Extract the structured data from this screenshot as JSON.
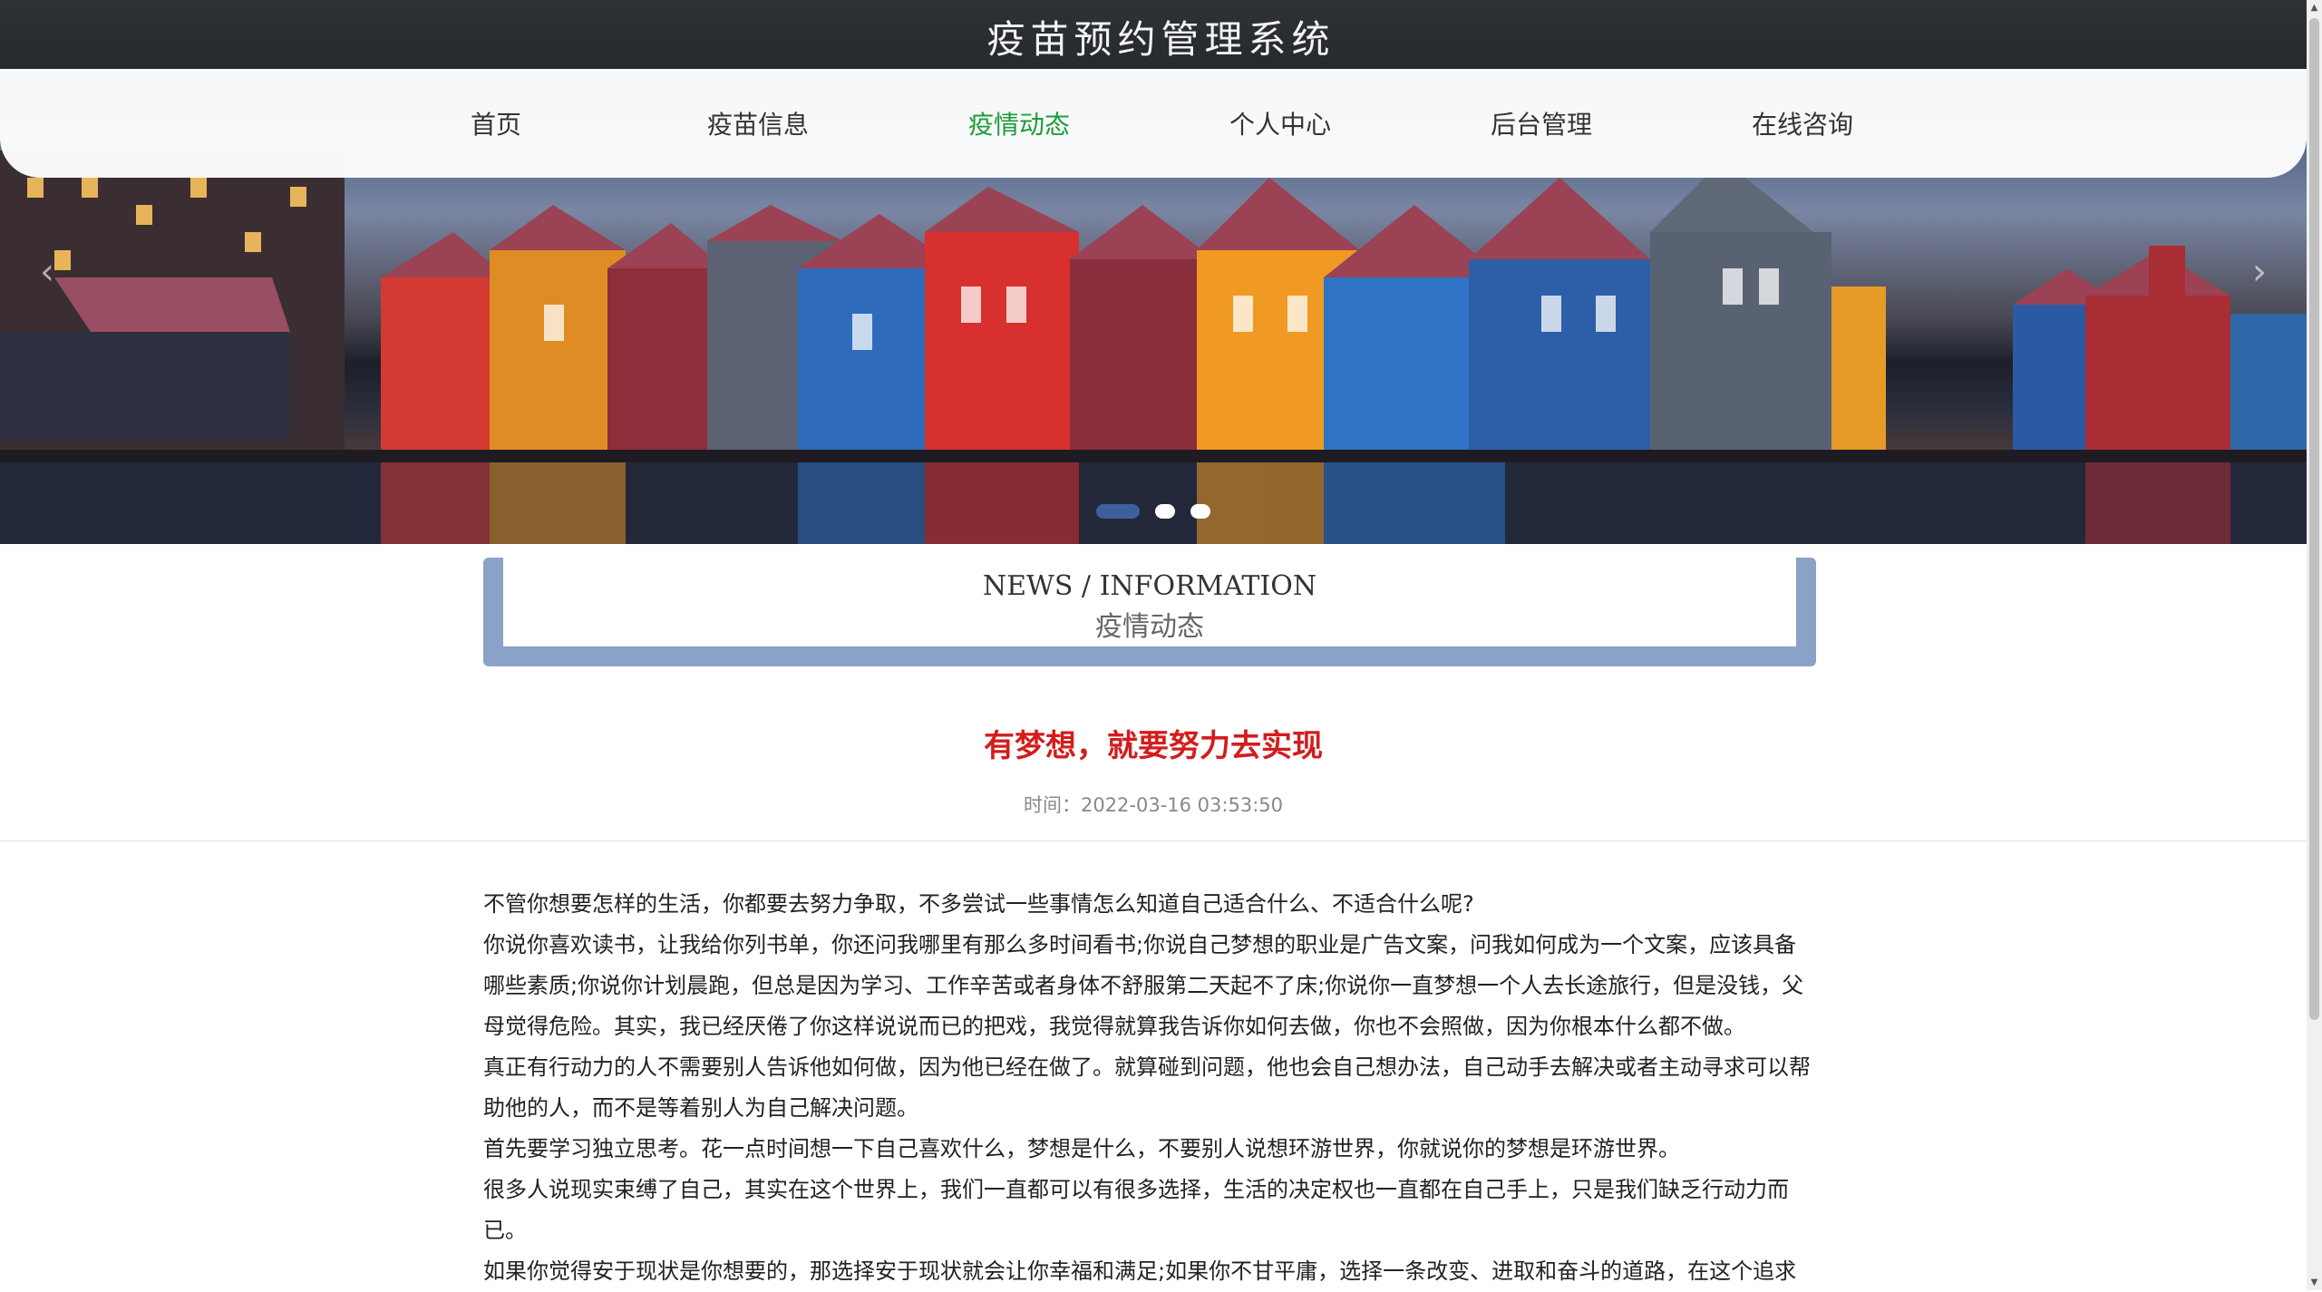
{
  "header": {
    "title": "疫苗预约管理系统"
  },
  "nav": {
    "items": [
      "首页",
      "疫苗信息",
      "疫情动态",
      "个人中心",
      "后台管理",
      "在线咨询"
    ],
    "active_index": 2
  },
  "carousel": {
    "slide_count": 3,
    "active_slide": 1
  },
  "section": {
    "en": "NEWS / INFORMATION",
    "cn": "疫情动态"
  },
  "article": {
    "title": "有梦想，就要努力去实现",
    "time": "时间：2022-03-16 03:53:50",
    "paragraphs": [
      "不管你想要怎样的生活，你都要去努力争取，不多尝试一些事情怎么知道自己适合什么、不适合什么呢?",
      "你说你喜欢读书，让我给你列书单，你还问我哪里有那么多时间看书;你说自己梦想的职业是广告文案，问我如何成为一个文案，应该具备哪些素质;你说你计划晨跑，但总是因为学习、工作辛苦或者身体不舒服第二天起不了床;你说你一直梦想一个人去长途旅行，但是没钱，父母觉得危险。其实，我已经厌倦了你这样说说而已的把戏，我觉得就算我告诉你如何去做，你也不会照做，因为你根本什么都不做。",
      "真正有行动力的人不需要别人告诉他如何做，因为他已经在做了。就算碰到问题，他也会自己想办法，自己动手去解决或者主动寻求可以帮助他的人，而不是等着别人为自己解决问题。",
      "首先要学习独立思考。花一点时间想一下自己喜欢什么，梦想是什么，不要别人说想环游世界，你就说你的梦想是环游世界。",
      "很多人说现实束缚了自己，其实在这个世界上，我们一直都可以有很多选择，生活的决定权也一直都在自己手上，只是我们缺乏行动力而已。",
      "如果你觉得安于现状是你想要的，那选择安于现状就会让你幸福和满足;如果你不甘平庸，选择一条改变、进取和奋斗的道路，在这个追求"
    ]
  },
  "colors": {
    "header_bg": "#2e3136",
    "nav_active": "#1e9c3a",
    "article_title": "#d41c1c",
    "section_border": "#8aa2c7",
    "carousel_dot_active": "#3d5f9e"
  }
}
